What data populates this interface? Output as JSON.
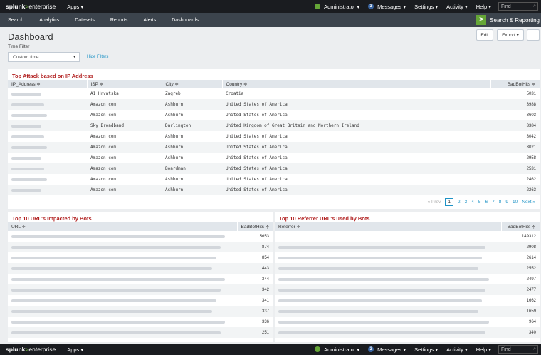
{
  "topbar": {
    "logo_main": "splunk",
    "logo_arrow": ">",
    "logo_suffix": "enterprise",
    "apps_label": "Apps ▾",
    "user_label": "Administrator ▾",
    "messages_count": "3",
    "messages_label": "Messages ▾",
    "settings_label": "Settings ▾",
    "activity_label": "Activity ▾",
    "help_label": "Help ▾",
    "find_placeholder": "Find"
  },
  "appbar": {
    "nav": [
      "Search",
      "Analytics",
      "Datasets",
      "Reports",
      "Alerts",
      "Dashboards"
    ],
    "app_name": "Search & Reporting"
  },
  "dashboard": {
    "title": "Dashboard",
    "time_filter_label": "Time Filter",
    "time_filter_value": "Custom time",
    "hide_filters": "Hide Filters",
    "edit_label": "Edit",
    "export_label": "Export ▾",
    "more_label": "..."
  },
  "attack_panel": {
    "title": "Top Attack based on IP Address",
    "columns": [
      "IP_Address ≑",
      "ISP ≑",
      "City ≑",
      "Country ≑",
      "BadBotHits ≑"
    ],
    "rows": [
      {
        "isp": "A1 Hrvatska",
        "city": "Zagreb",
        "country": "Croatia",
        "hits": "5031"
      },
      {
        "isp": "Amazon.com",
        "city": "Ashburn",
        "country": "United States of America",
        "hits": "3988"
      },
      {
        "isp": "Amazon.com",
        "city": "Ashburn",
        "country": "United States of America",
        "hits": "3603"
      },
      {
        "isp": "Sky Broadband",
        "city": "Darlington",
        "country": "United Kingdom of Great Britain and Northern Ireland",
        "hits": "3384"
      },
      {
        "isp": "Amazon.com",
        "city": "Ashburn",
        "country": "United States of America",
        "hits": "3042"
      },
      {
        "isp": "Amazon.com",
        "city": "Ashburn",
        "country": "United States of America",
        "hits": "3021"
      },
      {
        "isp": "Amazon.com",
        "city": "Ashburn",
        "country": "United States of America",
        "hits": "2958"
      },
      {
        "isp": "Amazon.com",
        "city": "Boardman",
        "country": "United States of America",
        "hits": "2531"
      },
      {
        "isp": "Amazon.com",
        "city": "Ashburn",
        "country": "United States of America",
        "hits": "2462"
      },
      {
        "isp": "Amazon.com",
        "city": "Ashburn",
        "country": "United States of America",
        "hits": "2263"
      }
    ],
    "pager": {
      "prev": "« Prev",
      "pages": [
        "1",
        "2",
        "3",
        "4",
        "5",
        "6",
        "7",
        "8",
        "9",
        "10"
      ],
      "next": "Next »"
    }
  },
  "url_panel": {
    "title": "Top 10 URL's Impacted by Bots",
    "columns": [
      "URL ≑",
      "BadBotHits ≑"
    ],
    "hits": [
      "5653",
      "874",
      "854",
      "443",
      "344",
      "342",
      "341",
      "337",
      "336",
      "251"
    ]
  },
  "referrer_panel": {
    "title": "Top 10 Referrer URL's used by Bots",
    "columns": [
      "Referrer ≑",
      "BadBotHits ≑"
    ],
    "hits": [
      "149312",
      "2908",
      "2614",
      "2552",
      "2497",
      "2477",
      "1662",
      "1659",
      "964",
      "340"
    ]
  },
  "colors": {
    "accent_green": "#65a637",
    "panel_title_red": "#b22222",
    "link_blue": "#1e93c6",
    "topbar": "#1a1c20",
    "appbar": "#3c444d"
  }
}
